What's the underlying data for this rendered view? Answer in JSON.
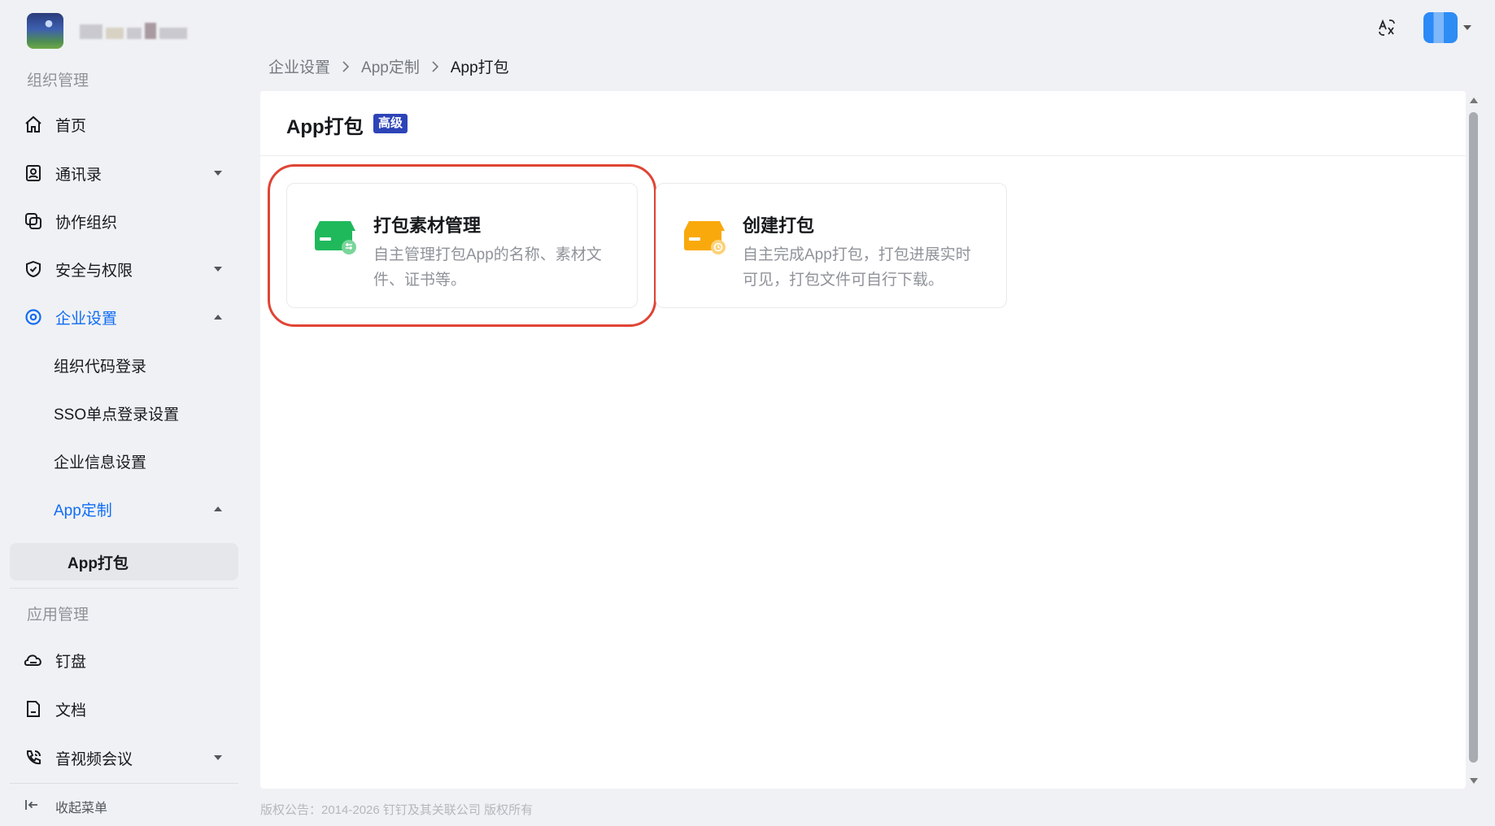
{
  "topbar": {
    "org_logo": "org-logo-image",
    "translate_icon": "translate-icon",
    "avatar": "user-avatar"
  },
  "sidebar": {
    "section_org": "组织管理",
    "items": [
      {
        "label": "首页",
        "icon": "home-icon"
      },
      {
        "label": "通讯录",
        "icon": "contacts-icon",
        "caret": "down"
      },
      {
        "label": "协作组织",
        "icon": "collab-org-icon"
      },
      {
        "label": "安全与权限",
        "icon": "shield-icon",
        "caret": "down"
      },
      {
        "label": "企业设置",
        "icon": "settings-icon",
        "caret": "up",
        "active": true
      }
    ],
    "sub_items": [
      {
        "label": "组织代码登录"
      },
      {
        "label": "SSO单点登录设置"
      },
      {
        "label": "企业信息设置"
      },
      {
        "label": "App定制",
        "caret": "up",
        "active": true
      }
    ],
    "selected_leaf": "App打包",
    "section_app": "应用管理",
    "app_items": [
      {
        "label": "钉盘",
        "icon": "cloud-drive-icon"
      },
      {
        "label": "文档",
        "icon": "document-icon"
      },
      {
        "label": "音视频会议",
        "icon": "video-call-icon",
        "caret": "down"
      }
    ],
    "collapse_label": "收起菜单"
  },
  "breadcrumb": [
    "企业设置",
    "App定制",
    "App打包"
  ],
  "page": {
    "title": "App打包",
    "badge": "高级"
  },
  "cards": [
    {
      "title": "打包素材管理",
      "desc": "自主管理打包App的名称、素材文件、证书等。",
      "icon": "package-materials-icon",
      "color": "#1fb95c"
    },
    {
      "title": "创建打包",
      "desc": "自主完成App打包，打包进展实时可见，打包文件可自行下载。",
      "icon": "create-package-icon",
      "color": "#f9a90b"
    }
  ],
  "colors": {
    "accent": "#0f6cf5",
    "badge_bg": "#2d44b8",
    "highlight": "#e04434"
  },
  "footer": "版权公告：2014-2026 钉钉及其关联公司 版权所有"
}
